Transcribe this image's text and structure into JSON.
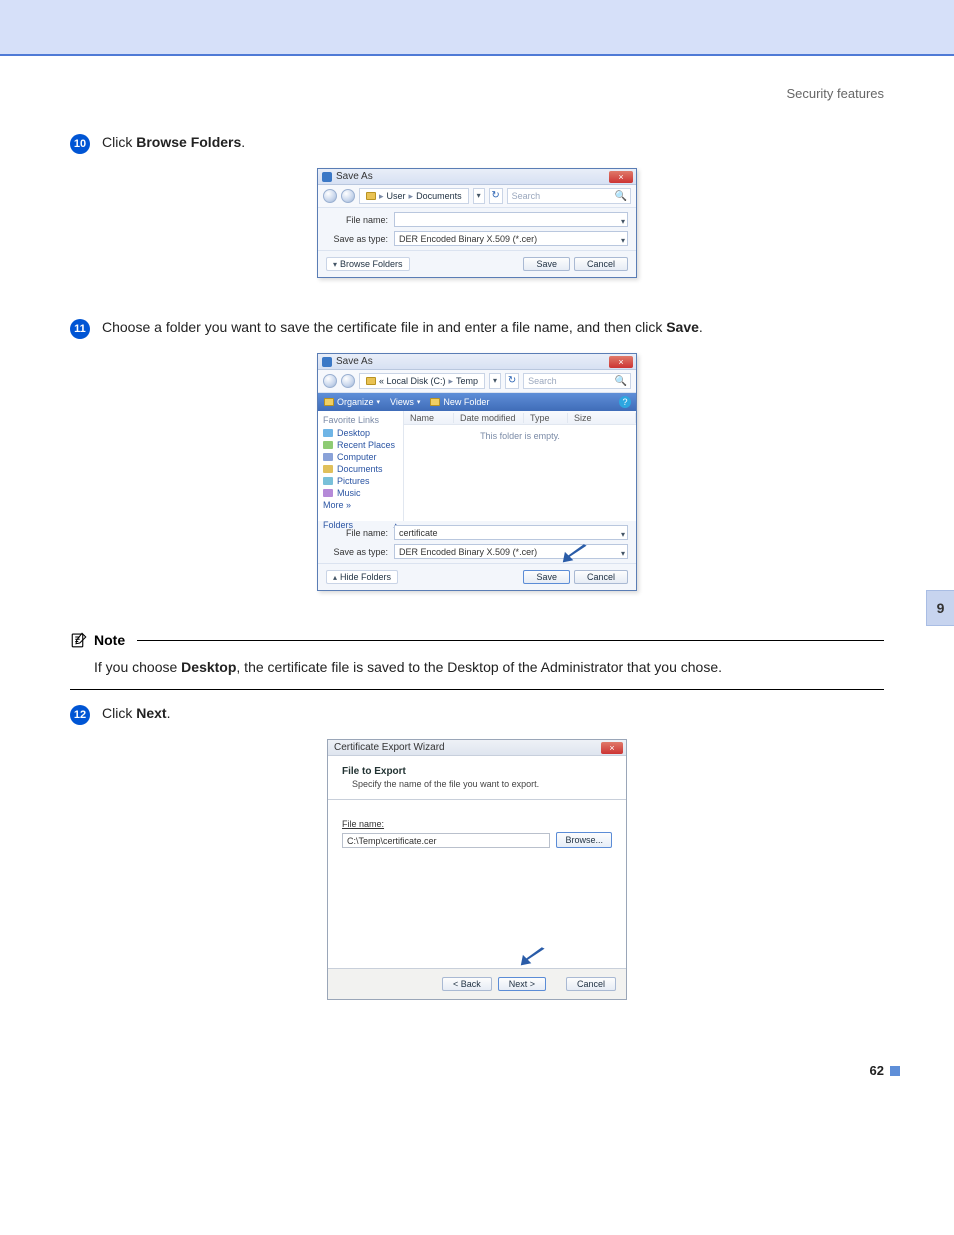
{
  "header": {
    "section": "Security features"
  },
  "chapter_tab": "9",
  "page_number": "62",
  "steps": {
    "s10": {
      "num": "10",
      "pre": "Click ",
      "bold": "Browse Folders",
      "post": "."
    },
    "s11": {
      "num": "11",
      "pre": "Choose a folder you want to save the certificate file in and enter a file name, and then click ",
      "bold": "Save",
      "post": "."
    },
    "s12": {
      "num": "12",
      "pre": "Click ",
      "bold": "Next",
      "post": "."
    }
  },
  "note": {
    "label": "Note",
    "pre": "If you choose ",
    "bold": "Desktop",
    "post": ", the certificate file is saved to the Desktop of the Administrator that you chose."
  },
  "dlg1": {
    "title": "Save As",
    "close": "×",
    "crumb_user": "User",
    "crumb_docs": "Documents",
    "nav_sep": "▸",
    "nav_drop": "▾",
    "refresh": "↻",
    "search_ph": "Search",
    "search_icon": "🔍",
    "filename_label": "File name:",
    "filename_value": "",
    "savetype_label": "Save as type:",
    "savetype_value": "DER Encoded Binary X.509 (*.cer)",
    "browse_folders": "Browse Folders",
    "browse_chev": "▾",
    "save": "Save",
    "cancel": "Cancel"
  },
  "dlg2": {
    "title": "Save As",
    "close": "×",
    "crumb_a": "« Local Disk (C:)",
    "crumb_b": "Temp",
    "nav_sep": "▸",
    "nav_drop": "▾",
    "refresh": "↻",
    "search_ph": "Search",
    "search_icon": "🔍",
    "toolbar": {
      "organize": "Organize",
      "views": "Views",
      "newfolder": "New Folder",
      "dd": "▾",
      "help": "?"
    },
    "favorites": "Favorite Links",
    "links": {
      "desktop": "Desktop",
      "recent": "Recent Places",
      "computer": "Computer",
      "documents": "Documents",
      "pictures": "Pictures",
      "music": "Music",
      "more": "More »"
    },
    "folders": "Folders",
    "folders_chev": "▴",
    "cols": {
      "name": "Name",
      "date": "Date modified",
      "type": "Type",
      "size": "Size"
    },
    "empty": "This folder is empty.",
    "filename_label": "File name:",
    "filename_value": "certificate",
    "savetype_label": "Save as type:",
    "savetype_value": "DER Encoded Binary X.509 (*.cer)",
    "hide_folders": "Hide Folders",
    "hide_chev": "▴",
    "save": "Save",
    "cancel": "Cancel"
  },
  "dlg3": {
    "title": "Certificate Export Wizard",
    "close": "×",
    "heading": "File to Export",
    "sub": "Specify the name of the file you want to export.",
    "filename_label": "File name:",
    "filename_value": "C:\\Temp\\certificate.cer",
    "browse": "Browse...",
    "back": "< Back",
    "next": "Next >",
    "cancel": "Cancel"
  }
}
